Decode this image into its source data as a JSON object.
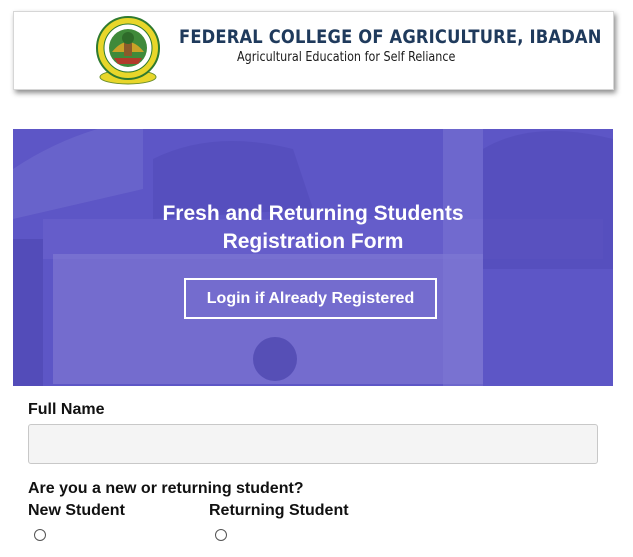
{
  "header": {
    "college_name": "FEDERAL COLLEGE OF AGRICULTURE, IBADAN",
    "motto": "Agricultural Education for Self Reliance",
    "logo_icon": "college-crest-icon"
  },
  "hero": {
    "title_line1": "Fresh and Returning Students",
    "title_line2": "Registration Form",
    "login_button": "Login if Already Registered",
    "background_color": "#5d56c6"
  },
  "form": {
    "full_name_label": "Full Name",
    "full_name_value": "",
    "student_type_question": "Are you a new or returning student?",
    "options": [
      {
        "label": "New Student",
        "selected": false
      },
      {
        "label": "Returning Student",
        "selected": false
      }
    ]
  }
}
